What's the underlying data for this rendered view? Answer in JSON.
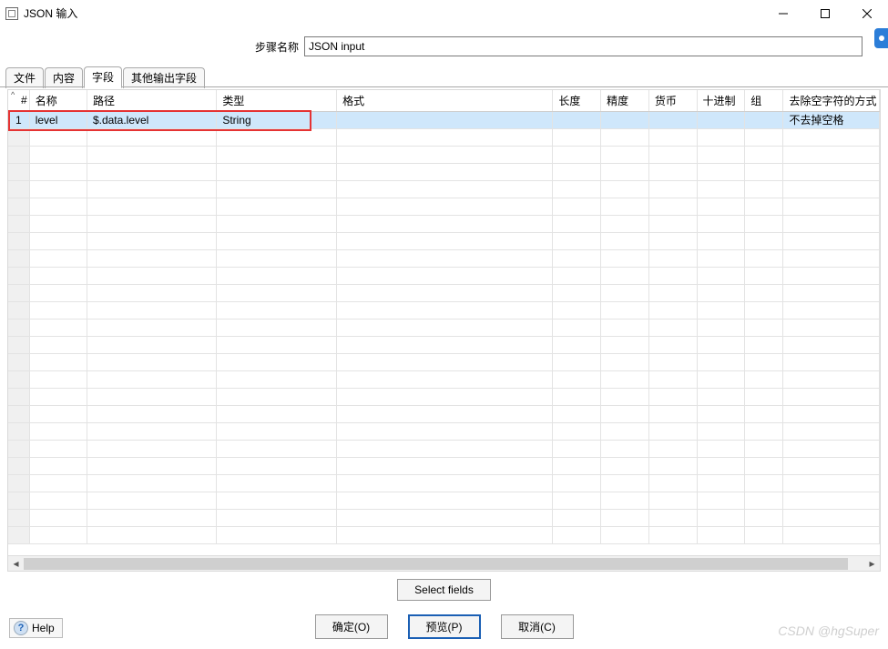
{
  "window": {
    "title": "JSON 输入",
    "minimize": "–",
    "maximize": "□",
    "close": "×"
  },
  "step": {
    "label": "步骤名称",
    "value": "JSON input"
  },
  "tabs": {
    "file": "文件",
    "content": "内容",
    "fields": "字段",
    "other": "其他输出字段"
  },
  "columns": {
    "idx": "#",
    "name": "名称",
    "path": "路径",
    "type": "类型",
    "format": "格式",
    "length": "长度",
    "precision": "精度",
    "currency": "货币",
    "decimal": "十进制",
    "group": "组",
    "trim": "去除空字符的方式"
  },
  "rows": [
    {
      "idx": "1",
      "name": "level",
      "path": "$.data.level",
      "type": "String",
      "format": "",
      "length": "",
      "precision": "",
      "currency": "",
      "decimal": "",
      "group": "",
      "trim": "不去掉空格"
    }
  ],
  "buttons": {
    "select_fields": "Select fields",
    "ok": "确定(O)",
    "preview": "预览(P)",
    "cancel": "取消(C)",
    "help": "Help"
  },
  "watermark": "CSDN @hgSuper"
}
